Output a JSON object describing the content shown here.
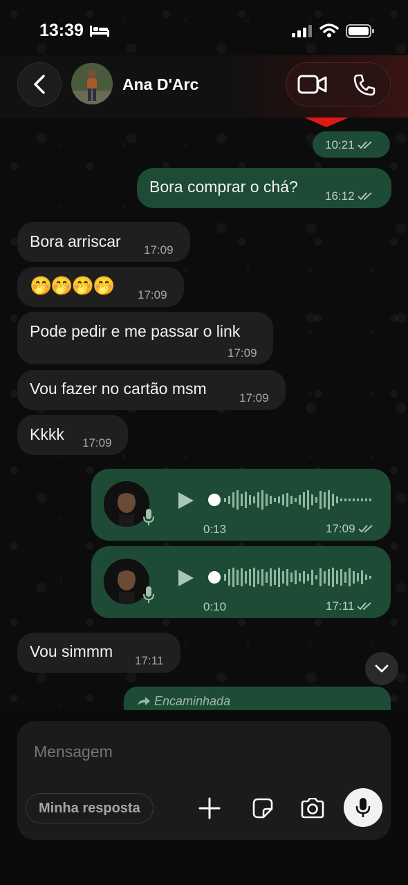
{
  "status_bar": {
    "time": "13:39",
    "icons": [
      "bed-icon",
      "signal-icon",
      "wifi-icon",
      "battery-icon"
    ]
  },
  "header": {
    "contact_name": "Ana D'Arc",
    "actions": [
      "video-call-icon",
      "phone-icon"
    ]
  },
  "messages": [
    {
      "direction": "out",
      "text": "",
      "time": "10:21",
      "read": true
    },
    {
      "direction": "out",
      "text": "Bora comprar o chá?",
      "time": "16:12",
      "read": true
    },
    {
      "direction": "in",
      "text": "Bora arriscar",
      "time": "17:09"
    },
    {
      "direction": "in",
      "text": "🤭🤭🤭🤭",
      "time": "17:09"
    },
    {
      "direction": "in",
      "text": "Pode pedir e me passar o link",
      "time": "17:09"
    },
    {
      "direction": "in",
      "text": "Vou fazer no cartão msm",
      "time": "17:09"
    },
    {
      "direction": "in",
      "text": "Kkkk",
      "time": "17:09"
    },
    {
      "direction": "out",
      "type": "voice",
      "duration": "0:13",
      "time": "17:09",
      "read": true
    },
    {
      "direction": "out",
      "type": "voice",
      "duration": "0:10",
      "time": "17:11",
      "read": true
    },
    {
      "direction": "in",
      "text": "Vou simmm",
      "time": "17:11"
    },
    {
      "direction": "out",
      "forwarded_label": "Encaminhada"
    }
  ],
  "composer": {
    "placeholder": "Mensagem",
    "quick_reply": "Minha resposta",
    "buttons": [
      "plus-icon",
      "sticker-icon",
      "camera-icon",
      "microphone-icon"
    ]
  },
  "colors": {
    "outgoing_bubble": "#1e4b35",
    "incoming_bubble": "#1f1f1f",
    "background": "#0b0b0b"
  }
}
